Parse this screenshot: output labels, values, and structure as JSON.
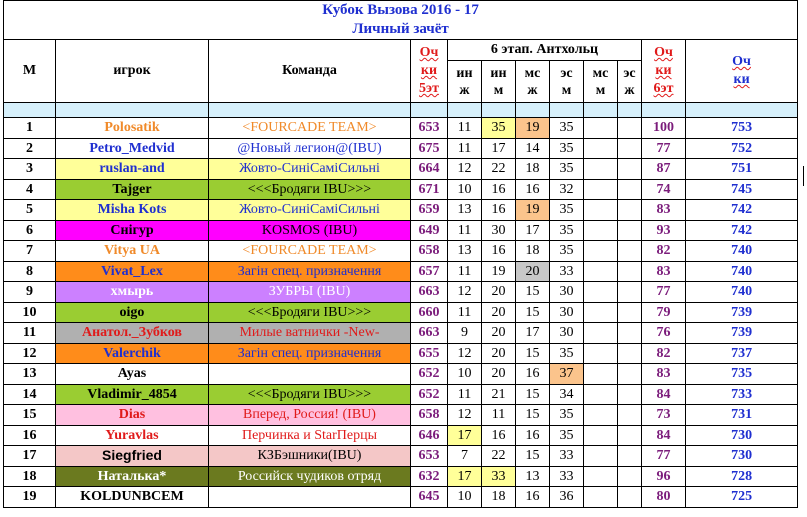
{
  "title": "Кубок Вызова 2016 - 17",
  "subtitle": "Личный зачёт",
  "headers": {
    "place": "М",
    "player": "игрок",
    "team": "Команда",
    "pts5": [
      "Оч",
      "ки",
      "5эт"
    ],
    "stage": "6 этап. Антхольц",
    "cols": [
      [
        "ин",
        "ж"
      ],
      [
        "ин",
        "м"
      ],
      [
        "мс",
        "ж"
      ],
      [
        "эс",
        "м"
      ],
      [
        "мс",
        "м"
      ],
      [
        "эс",
        "ж"
      ]
    ],
    "pts6": [
      "Оч",
      "ки",
      "6эт"
    ],
    "total": [
      "Оч",
      "ки"
    ]
  },
  "colors": {
    "title_blue": "#1f2fd0",
    "purple": "#7b1c7b",
    "spacer": "#d6f0fb",
    "yellow_cell": "#ffff99",
    "orange_cell": "#fbc48c",
    "gray_cell": "#c8c8c8"
  },
  "rows": [
    {
      "place": "1",
      "player": "Polosatik",
      "team": "<FOURCADE  TEAM>",
      "p5": "653",
      "c": [
        "11",
        "35",
        "19",
        "35",
        "",
        ""
      ],
      "p6": "100",
      "total": "753",
      "bg": "#ffffff",
      "pColor": "#f08a2a",
      "tColor": "#f08a2a",
      "pFont": "serif",
      "hl": [
        "",
        "hl-yellow",
        "hl-orange",
        "",
        "",
        ""
      ]
    },
    {
      "place": "2",
      "player": "Petro_Medvid",
      "team": "@Новый легион@(IBU)",
      "p5": "675",
      "c": [
        "11",
        "17",
        "14",
        "35",
        "",
        ""
      ],
      "p6": "77",
      "total": "752",
      "bg": "#ffffff",
      "pColor": "#1f2fd0",
      "tColor": "#1f2fd0",
      "pFont": "serif",
      "hl": [
        "",
        "",
        "",
        "",
        "",
        ""
      ]
    },
    {
      "place": "3",
      "player": "ruslan-and",
      "team": "Жовто-СиніСаміСильні",
      "p5": "664",
      "c": [
        "12",
        "22",
        "18",
        "35",
        "",
        ""
      ],
      "p6": "87",
      "total": "751",
      "bg": "#ffff99",
      "pColor": "#1f2fd0",
      "tColor": "#1f2fd0",
      "pFont": "serif",
      "hl": [
        "",
        "",
        "",
        "",
        "",
        ""
      ]
    },
    {
      "place": "4",
      "player": "Tajger",
      "team": "<<<Бродяги IBU>>>",
      "p5": "671",
      "c": [
        "10",
        "16",
        "16",
        "32",
        "",
        ""
      ],
      "p6": "74",
      "total": "745",
      "bg": "#9acd32",
      "pColor": "#000000",
      "tColor": "#000000",
      "pFont": "serif",
      "hl": [
        "",
        "",
        "",
        "",
        "",
        ""
      ]
    },
    {
      "place": "5",
      "player": "Misha Kots",
      "team": "Жовто-СиніСаміСильні",
      "p5": "659",
      "c": [
        "13",
        "16",
        "19",
        "35",
        "",
        ""
      ],
      "p6": "83",
      "total": "742",
      "bg": "#ffff99",
      "pColor": "#1f2fd0",
      "tColor": "#1f2fd0",
      "pFont": "serif",
      "hl": [
        "",
        "",
        "hl-orange",
        "",
        "",
        ""
      ]
    },
    {
      "place": "6",
      "player": "Снігур",
      "team": "KOSMOS (IBU)",
      "p5": "649",
      "c": [
        "11",
        "30",
        "17",
        "35",
        "",
        ""
      ],
      "p6": "93",
      "total": "742",
      "bg": "#ff00ff",
      "pColor": "#000000",
      "tColor": "#000000",
      "pFont": "serif",
      "hl": [
        "",
        "",
        "",
        "",
        "",
        ""
      ]
    },
    {
      "place": "7",
      "player": "Vitya UA",
      "team": "<FOURCADE  TEAM>",
      "p5": "658",
      "c": [
        "13",
        "16",
        "18",
        "35",
        "",
        ""
      ],
      "p6": "82",
      "total": "740",
      "bg": "#ffffff",
      "pColor": "#f08a2a",
      "tColor": "#f08a2a",
      "pFont": "serif",
      "hl": [
        "",
        "",
        "",
        "",
        "",
        ""
      ]
    },
    {
      "place": "8",
      "player": "Vivat_Lex",
      "team": "Загін спец. призначення",
      "p5": "657",
      "c": [
        "11",
        "19",
        "20",
        "33",
        "",
        ""
      ],
      "p6": "83",
      "total": "740",
      "bg": "#ff8c1a",
      "pColor": "#1f2fd0",
      "tColor": "#1f2fd0",
      "pFont": "serif",
      "hl": [
        "",
        "",
        "hl-gray",
        "",
        "",
        ""
      ]
    },
    {
      "place": "9",
      "player": "хмырь",
      "team": "ЗУБРЫ (IBU)",
      "p5": "663",
      "c": [
        "12",
        "20",
        "15",
        "30",
        "",
        ""
      ],
      "p6": "77",
      "total": "740",
      "bg": "#cc80ff",
      "pColor": "#ffffff",
      "tColor": "#ffffff",
      "pFont": "serif",
      "hl": [
        "",
        "",
        "",
        "",
        "",
        ""
      ]
    },
    {
      "place": "10",
      "player": "oigo",
      "team": "<<<Бродяги IBU>>>",
      "p5": "660",
      "c": [
        "11",
        "20",
        "15",
        "30",
        "",
        ""
      ],
      "p6": "79",
      "total": "739",
      "bg": "#9acd32",
      "pColor": "#000000",
      "tColor": "#000000",
      "pFont": "serif",
      "hl": [
        "",
        "",
        "",
        "",
        "",
        ""
      ]
    },
    {
      "place": "11",
      "player": "Анатол._Зубков",
      "team": "Милые ватнички -New-",
      "p5": "663",
      "c": [
        "9",
        "20",
        "17",
        "30",
        "",
        ""
      ],
      "p6": "76",
      "total": "739",
      "bg": "#b0b0b0",
      "pColor": "#e01a1a",
      "tColor": "#e01a1a",
      "pFont": "serif",
      "hl": [
        "",
        "",
        "",
        "",
        "",
        ""
      ]
    },
    {
      "place": "12",
      "player": "Valerchik",
      "team": "Загін спец. призначення",
      "p5": "655",
      "c": [
        "12",
        "20",
        "15",
        "35",
        "",
        ""
      ],
      "p6": "82",
      "total": "737",
      "bg": "#ff8c1a",
      "pColor": "#1f2fd0",
      "tColor": "#1f2fd0",
      "pFont": "serif",
      "hl": [
        "",
        "",
        "",
        "",
        "",
        ""
      ]
    },
    {
      "place": "13",
      "player": "Ayas",
      "team": "",
      "p5": "652",
      "c": [
        "10",
        "20",
        "16",
        "37",
        "",
        ""
      ],
      "p6": "83",
      "total": "735",
      "bg": "#ffffff",
      "pColor": "#000000",
      "tColor": "#000000",
      "pFont": "serif",
      "hl": [
        "",
        "",
        "",
        "hl-orange",
        "",
        ""
      ]
    },
    {
      "place": "14",
      "player": "Vladimir_4854",
      "team": "<<<Бродяги IBU>>>",
      "p5": "652",
      "c": [
        "11",
        "21",
        "15",
        "34",
        "",
        ""
      ],
      "p6": "84",
      "total": "733",
      "bg": "#9acd32",
      "pColor": "#000000",
      "tColor": "#000000",
      "pFont": "serif",
      "hl": [
        "",
        "",
        "",
        "",
        "",
        ""
      ]
    },
    {
      "place": "15",
      "player": "Dias",
      "team": "Вперед, Россия! (IBU)",
      "p5": "658",
      "c": [
        "12",
        "11",
        "15",
        "35",
        "",
        ""
      ],
      "p6": "73",
      "total": "731",
      "bg": "#ffc0e0",
      "pColor": "#e01a1a",
      "tColor": "#e01a1a",
      "pFont": "serif",
      "hl": [
        "",
        "",
        "",
        "",
        "",
        ""
      ]
    },
    {
      "place": "16",
      "player": "Yuravlas",
      "team": "Перчинка и StarПерцы",
      "p5": "646",
      "c": [
        "17",
        "16",
        "16",
        "35",
        "",
        ""
      ],
      "p6": "84",
      "total": "730",
      "bg": "#ffffff",
      "pColor": "#e01a1a",
      "tColor": "#e01a1a",
      "pFont": "serif",
      "hl": [
        "hl-yellow",
        "",
        "",
        "",
        "",
        ""
      ]
    },
    {
      "place": "17",
      "player": "Siegfried",
      "team": "КЗБэшники(IBU)",
      "p5": "653",
      "c": [
        "7",
        "22",
        "15",
        "33",
        "",
        ""
      ],
      "p6": "77",
      "total": "730",
      "bg": "#f4c7c7",
      "pColor": "#000000",
      "tColor": "#000000",
      "pFont": "sans",
      "hl": [
        "",
        "",
        "",
        "",
        "",
        ""
      ]
    },
    {
      "place": "18",
      "player": "Наталька*",
      "team": "Российск чудиков отряд",
      "p5": "632",
      "c": [
        "17",
        "33",
        "13",
        "33",
        "",
        ""
      ],
      "p6": "96",
      "total": "728",
      "bg": "#6b7a1f",
      "pColor": "#ffffff",
      "tColor": "#ffffff",
      "pFont": "serif",
      "hl": [
        "hl-yellow",
        "hl-yellow",
        "",
        "",
        "",
        ""
      ]
    },
    {
      "place": "19",
      "player": "KOLDUNBCEM",
      "team": "",
      "p5": "645",
      "c": [
        "10",
        "18",
        "16",
        "36",
        "",
        ""
      ],
      "p6": "80",
      "total": "725",
      "bg": "#ffffff",
      "pColor": "#000000",
      "tColor": "#000000",
      "pFont": "serif",
      "hl": [
        "",
        "",
        "",
        "",
        "",
        ""
      ]
    }
  ]
}
